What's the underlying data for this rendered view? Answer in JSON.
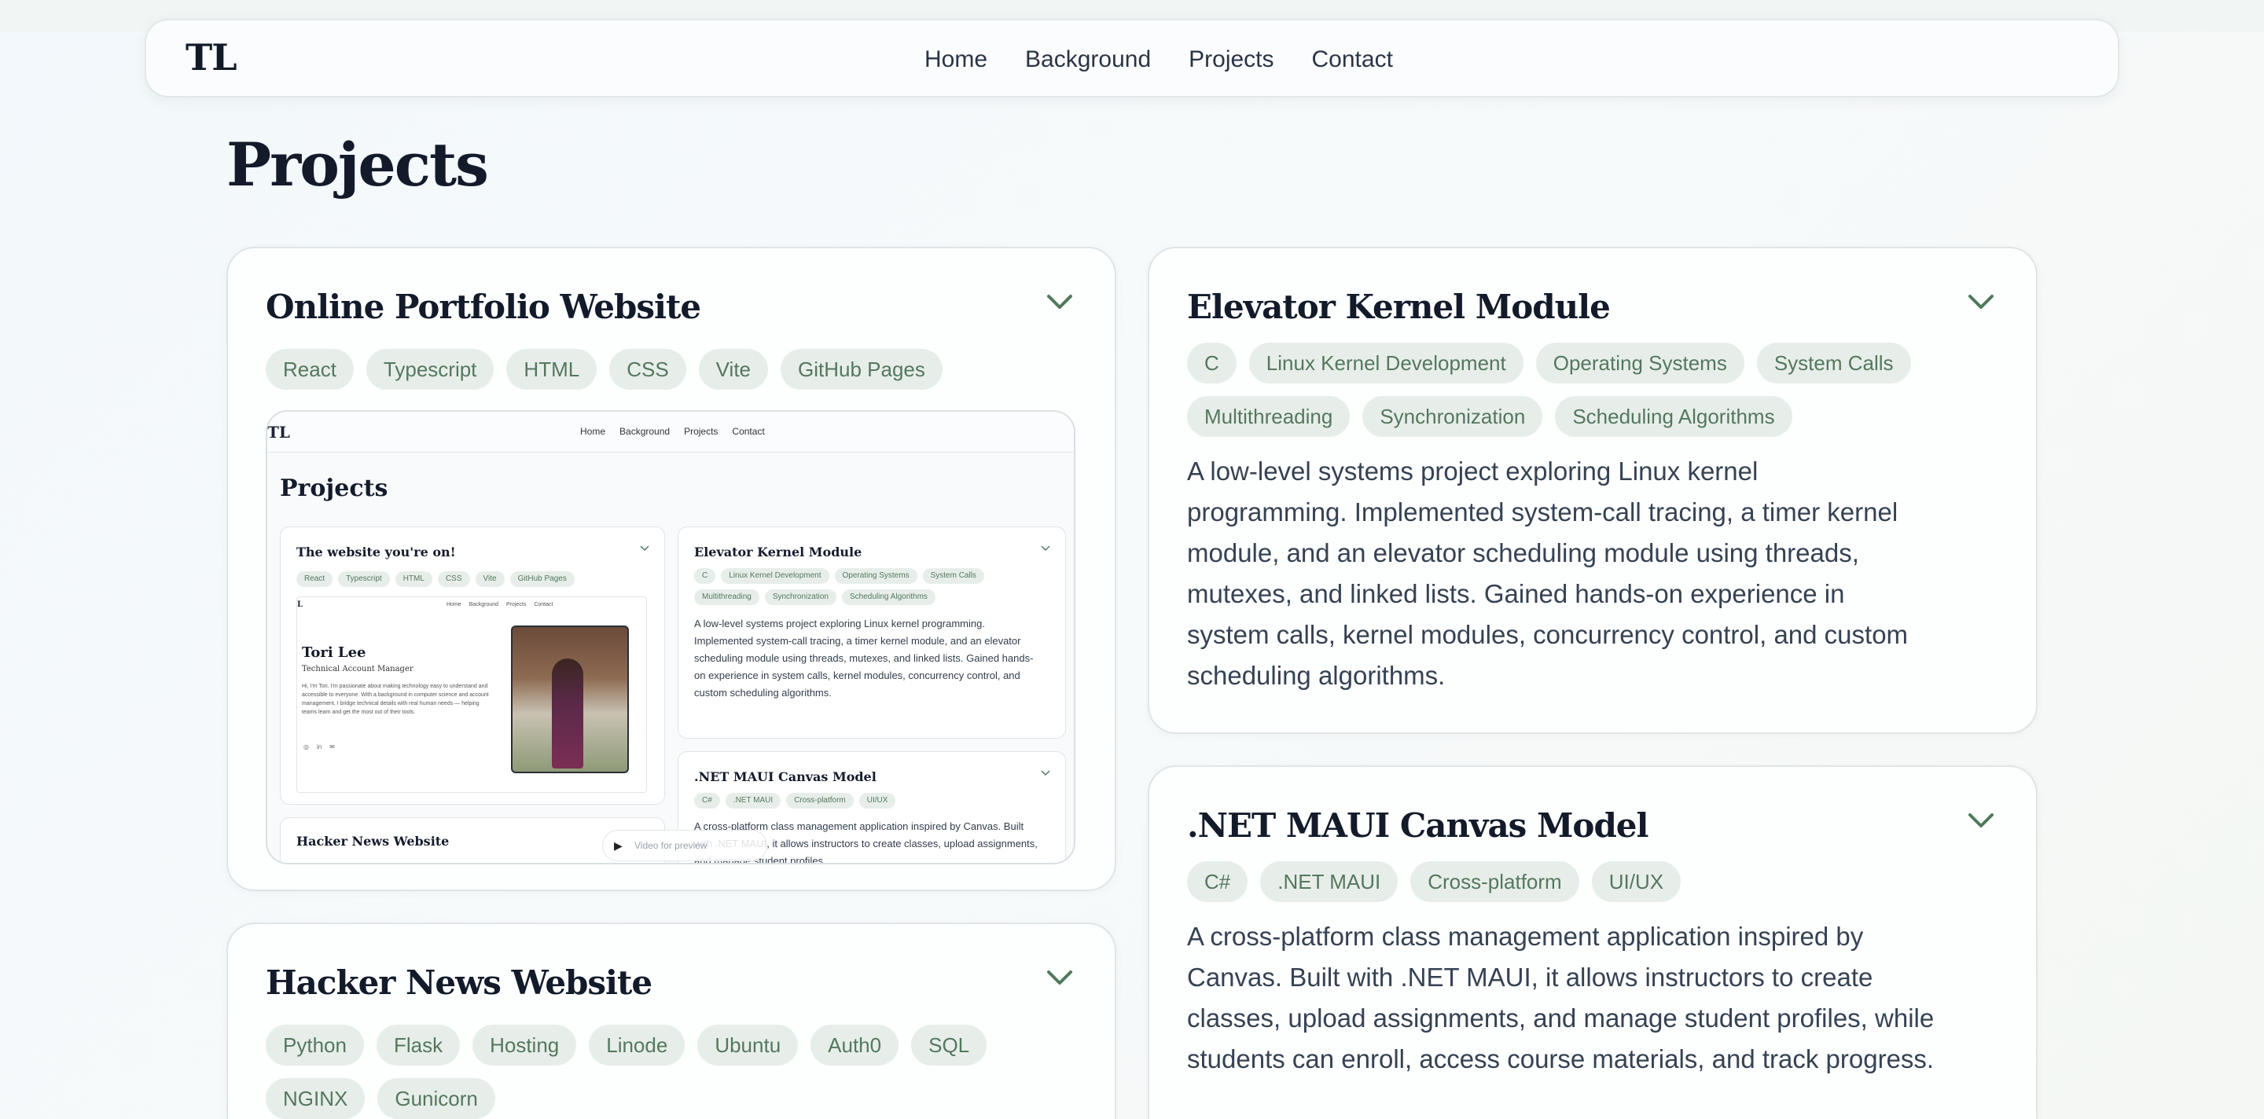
{
  "nav": {
    "logo": "TL",
    "links": [
      "Home",
      "Background",
      "Projects",
      "Contact"
    ]
  },
  "page_title": "Projects",
  "projects": [
    {
      "title": "Online Portfolio Website",
      "tags": [
        "React",
        "Typescript",
        "HTML",
        "CSS",
        "Vite",
        "GitHub Pages"
      ],
      "preview": {
        "logo": "TL",
        "nav_links": [
          "Home",
          "Background",
          "Projects",
          "Contact"
        ],
        "page_title": "Projects",
        "card1_title": "The website you're on!",
        "card1_tags": [
          "React",
          "Typescript",
          "HTML",
          "CSS",
          "Vite",
          "GitHub Pages"
        ],
        "inner_logo": "L",
        "inner_links": [
          "Home",
          "Background",
          "Projects",
          "Contact"
        ],
        "person_name": "Tori Lee",
        "person_role": "Technical Account Manager",
        "person_blurb": "Hi, I'm Tori. I'm passionate about making technology easy to understand and accessible to everyone. With a background in computer science and account management, I bridge technical details with real human needs — helping teams learn and get the most out of their tools.",
        "card2_title": "Hacker News Website",
        "video_label": "Video for preview",
        "elev_title": "Elevator Kernel Module",
        "elev_tags": [
          "C",
          "Linux Kernel Development",
          "Operating Systems",
          "System Calls",
          "Multithreading",
          "Synchronization",
          "Scheduling Algorithms"
        ],
        "elev_desc": "A low-level systems project exploring Linux kernel programming. Implemented system-call tracing, a timer kernel module, and an elevator scheduling module using threads, mutexes, and linked lists. Gained hands-on experience in system calls, kernel modules, concurrency control, and custom scheduling algorithms.",
        "maui_title": ".NET MAUI Canvas Model",
        "maui_tags": [
          "C#",
          ".NET MAUI",
          "Cross-platform",
          "UI/UX"
        ],
        "maui_desc": "A cross-platform class management application inspired by Canvas. Built with .NET MAUI, it allows instructors to create classes, upload assignments, and manage student profiles,"
      }
    },
    {
      "title": "Hacker News Website",
      "tags": [
        "Python",
        "Flask",
        "Hosting",
        "Linode",
        "Ubuntu",
        "Auth0",
        "SQL",
        "NGINX",
        "Gunicorn"
      ]
    },
    {
      "title": "Elevator Kernel Module",
      "tags": [
        "C",
        "Linux Kernel Development",
        "Operating Systems",
        "System Calls",
        "Multithreading",
        "Synchronization",
        "Scheduling Algorithms"
      ],
      "description": "A low-level systems project exploring Linux kernel programming. Implemented system-call tracing, a timer kernel module, and an elevator scheduling module using threads, mutexes, and linked lists. Gained hands-on experience in system calls, kernel modules, concurrency control, and custom scheduling algorithms."
    },
    {
      "title": ".NET MAUI Canvas Model",
      "tags": [
        "C#",
        ".NET MAUI",
        "Cross-platform",
        "UI/UX"
      ],
      "description": "A cross-platform class management application inspired by Canvas. Built with .NET MAUI, it allows instructors to create classes, upload assignments, and manage student profiles, while students can enroll, access course materials, and track progress."
    }
  ],
  "colors": {
    "tag_bg": "#e7eee9",
    "tag_text": "#55775f",
    "chevron": "#4f7a5a",
    "heading": "#131b2b"
  },
  "icons": [
    "chevron-down-icon",
    "play-icon"
  ]
}
